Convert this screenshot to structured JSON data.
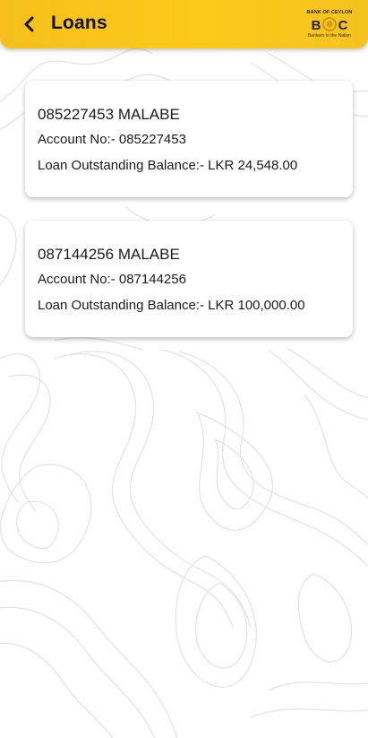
{
  "header": {
    "title": "Loans",
    "back_icon": "chevron-left-icon",
    "logo": {
      "bank_name": "BANK OF CEYLON",
      "mark": "BOC",
      "tagline": "Bankers to the Nation"
    },
    "accent_color": "#fcca1a"
  },
  "loans": [
    {
      "title": "085227453 MALABE",
      "account_no": "Account No:- 085227453",
      "balance": "Loan Outstanding Balance:- LKR 24,548.00"
    },
    {
      "title": "087144256 MALABE",
      "account_no": "Account No:- 087144256",
      "balance": "Loan Outstanding Balance:- LKR 100,000.00"
    }
  ]
}
